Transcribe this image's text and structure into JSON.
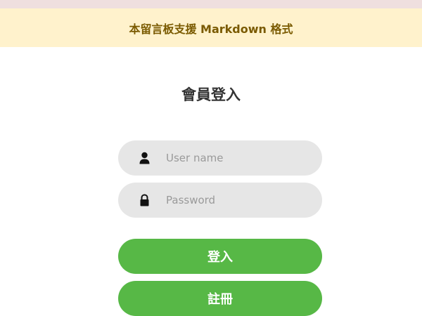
{
  "notice": {
    "text": "本留言板支援 Markdown 格式"
  },
  "login": {
    "title": "會員登入",
    "username_placeholder": "User name",
    "password_placeholder": "Password",
    "login_button": "登入",
    "register_button": "註冊"
  },
  "colors": {
    "notice_bg": "#fff2cc",
    "notice_text": "#7a5a00",
    "field_bg": "#e6e6e6",
    "button_green": "#57b846"
  },
  "icons": {
    "username": "user-icon",
    "password": "lock-icon"
  }
}
